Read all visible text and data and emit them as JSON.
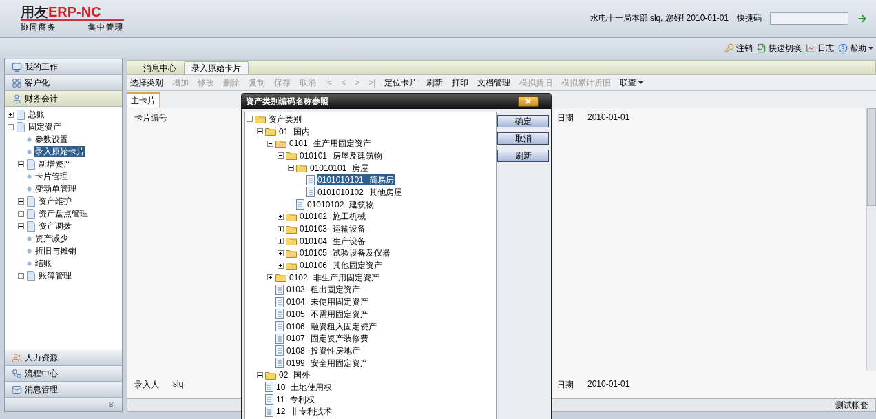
{
  "header": {
    "logo": {
      "brand": "用友",
      "product": "ERP-NC",
      "tagline_left": "协同商务",
      "tagline_right": "集中管理"
    },
    "greeting": "水电十一局本部 slq, 您好! 2010-01-01",
    "shortcut_label": "快捷码"
  },
  "top_actions": [
    {
      "label": "注销",
      "kind": "key"
    },
    {
      "label": "快速切换",
      "kind": "switch"
    },
    {
      "label": "日志",
      "kind": "log"
    },
    {
      "label": "帮助",
      "kind": "help",
      "menu": true
    }
  ],
  "sidebar": {
    "groups_top": [
      {
        "label": "我的工作",
        "kind": "work",
        "selected": false
      },
      {
        "label": "客户化",
        "kind": "custom",
        "selected": false
      },
      {
        "label": "财务会计",
        "kind": "finance",
        "selected": true
      }
    ],
    "tree": [
      {
        "label": "总账",
        "kind": "page",
        "expanded": false
      },
      {
        "label": "固定资产",
        "kind": "page",
        "expanded": true,
        "children": [
          {
            "label": "参数设置",
            "kind": "leaf",
            "selected": false
          },
          {
            "label": "录入原始卡片",
            "kind": "leaf",
            "selected": true
          },
          {
            "label": "新增资产",
            "kind": "page",
            "expanded": false
          },
          {
            "label": "卡片管理",
            "kind": "leaf",
            "selected": false
          },
          {
            "label": "变动单管理",
            "kind": "leaf",
            "selected": false
          },
          {
            "label": "资产维护",
            "kind": "page",
            "expanded": false
          },
          {
            "label": "资产盘点管理",
            "kind": "page",
            "expanded": false
          },
          {
            "label": "资产调拨",
            "kind": "page",
            "expanded": false
          },
          {
            "label": "资产减少",
            "kind": "leaf",
            "selected": false
          },
          {
            "label": "折旧与摊销",
            "kind": "leaf",
            "selected": false
          },
          {
            "label": "结账",
            "kind": "leaf",
            "selected": false
          },
          {
            "label": "账簿管理",
            "kind": "page",
            "expanded": false
          }
        ]
      }
    ],
    "groups_bottom": [
      {
        "label": "人力资源",
        "kind": "hr"
      },
      {
        "label": "流程中心",
        "kind": "flow"
      },
      {
        "label": "消息管理",
        "kind": "mail"
      }
    ]
  },
  "tabs": [
    {
      "label": "消息中心",
      "selected": false
    },
    {
      "label": "录入原始卡片",
      "selected": true
    }
  ],
  "toolbar": [
    {
      "label": "选择类别",
      "disabled": false
    },
    {
      "label": "增加",
      "disabled": true
    },
    {
      "label": "修改",
      "disabled": true
    },
    {
      "label": "删除",
      "disabled": true
    },
    {
      "label": "复制",
      "disabled": true
    },
    {
      "label": "保存",
      "disabled": true
    },
    {
      "label": "取消",
      "disabled": true
    },
    {
      "label": "|<",
      "disabled": true
    },
    {
      "label": "<",
      "disabled": true
    },
    {
      "label": ">",
      "disabled": true
    },
    {
      "label": ">|",
      "disabled": true
    },
    {
      "label": "定位卡片",
      "disabled": false
    },
    {
      "label": "刷新",
      "disabled": false
    },
    {
      "label": "打印",
      "disabled": false
    },
    {
      "label": "文档管理",
      "disabled": false
    },
    {
      "label": "模拟折旧",
      "disabled": true
    },
    {
      "label": "模拟累计折旧",
      "disabled": true
    },
    {
      "label": "联查",
      "disabled": false,
      "menu": true
    }
  ],
  "card_tabs": [
    {
      "label": "主卡片",
      "selected": true
    }
  ],
  "form": {
    "top": [
      {
        "label": "卡片编号"
      },
      {
        "label": "日期",
        "value": "2010-01-01"
      }
    ],
    "bottom": [
      {
        "label": "录入人",
        "value": "slq"
      },
      {
        "label": "日期",
        "value": "2010-01-01"
      }
    ]
  },
  "status_bar": {
    "text": "测试帐套"
  },
  "dialog": {
    "title": "资产类别编码名称参照",
    "buttons": [
      "确定",
      "取消",
      "刷新"
    ],
    "tree": [
      {
        "name": "资产类别",
        "kind": "folder",
        "expanded": true,
        "children": [
          {
            "code": "01",
            "name": "国内",
            "kind": "folder",
            "expanded": true,
            "children": [
              {
                "code": "0101",
                "name": "生产用固定资产",
                "kind": "folder",
                "expanded": true,
                "children": [
                  {
                    "code": "010101",
                    "name": "房屋及建筑物",
                    "kind": "folder",
                    "expanded": true,
                    "children": [
                      {
                        "code": "01010101",
                        "name": "房屋",
                        "kind": "folder",
                        "expanded": true,
                        "children": [
                          {
                            "code": "0101010101",
                            "name": "简易房",
                            "kind": "doc",
                            "selected": true
                          },
                          {
                            "code": "0101010102",
                            "name": "其他房屋",
                            "kind": "doc",
                            "selected": false
                          }
                        ]
                      },
                      {
                        "code": "01010102",
                        "name": "建筑物",
                        "kind": "doc",
                        "selected": false
                      }
                    ]
                  },
                  {
                    "code": "010102",
                    "name": "施工机械",
                    "kind": "folder",
                    "expanded": false
                  },
                  {
                    "code": "010103",
                    "name": "运输设备",
                    "kind": "folder",
                    "expanded": false
                  },
                  {
                    "code": "010104",
                    "name": "生产设备",
                    "kind": "folder",
                    "expanded": false
                  },
                  {
                    "code": "010105",
                    "name": "试验设备及仪器",
                    "kind": "folder",
                    "expanded": false
                  },
                  {
                    "code": "010106",
                    "name": "其他固定资产",
                    "kind": "folder",
                    "expanded": false
                  }
                ]
              },
              {
                "code": "0102",
                "name": "非生产用固定资产",
                "kind": "folder",
                "expanded": false
              },
              {
                "code": "0103",
                "name": "租出固定资产",
                "kind": "doc",
                "selected": false
              },
              {
                "code": "0104",
                "name": "未使用固定资产",
                "kind": "doc",
                "selected": false
              },
              {
                "code": "0105",
                "name": "不需用固定资产",
                "kind": "doc",
                "selected": false
              },
              {
                "code": "0106",
                "name": "融资租入固定资产",
                "kind": "doc",
                "selected": false
              },
              {
                "code": "0107",
                "name": "固定资产装修费",
                "kind": "doc",
                "selected": false
              },
              {
                "code": "0108",
                "name": "投资性房地产",
                "kind": "doc",
                "selected": false
              },
              {
                "code": "0199",
                "name": "安全用固定资产",
                "kind": "doc",
                "selected": false
              }
            ]
          },
          {
            "code": "02",
            "name": "国外",
            "kind": "folder",
            "expanded": false
          },
          {
            "code": "10",
            "name": "土地使用权",
            "kind": "doc",
            "selected": false
          },
          {
            "code": "11",
            "name": "专利权",
            "kind": "doc",
            "selected": false
          },
          {
            "code": "12",
            "name": "非专利技术",
            "kind": "doc",
            "selected": false
          }
        ]
      }
    ]
  }
}
